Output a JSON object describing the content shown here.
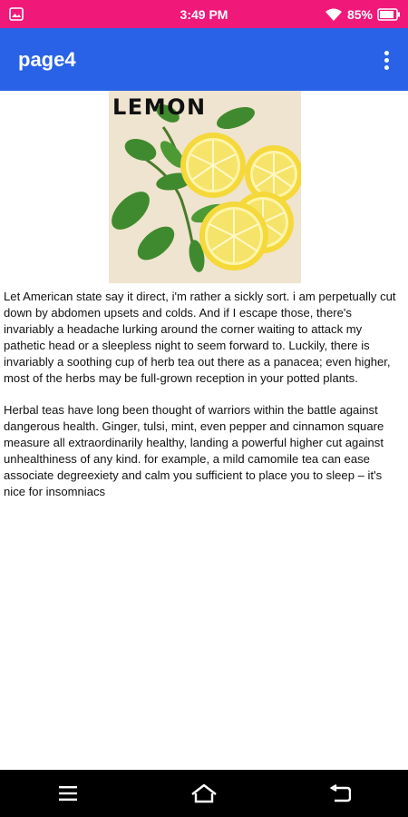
{
  "status_bar": {
    "time": "3:49 PM",
    "battery_percent": "85%",
    "icons": [
      "image-icon",
      "wifi-icon",
      "battery-icon"
    ]
  },
  "app_bar": {
    "title": "page4",
    "overflow_icon": "more-vert-icon"
  },
  "hero_image": {
    "title": "LEMON"
  },
  "article": {
    "paragraphs": [
      "Let American state say it direct, i'm rather a sickly sort. i am perpetually cut down by abdomen upsets and colds. And if I escape those, there's invariably a headache lurking around the corner waiting to attack my pathetic head or a sleepless night to seem forward to. Luckily, there is invariably a soothing cup of herb tea out there as a panacea; even higher, most of the herbs may be full-grown reception in your potted plants.",
      "Herbal teas have long been thought of warriors within the battle against dangerous health. Ginger, tulsi, mint, even pepper and cinnamon square measure all extraordinarily healthy, landing a powerful higher cut against unhealthiness of any kind. for example, a mild camomile tea can ease associate degreexiety and calm you sufficient to place you to sleep – it's nice for insomniacs"
    ]
  },
  "nav_bar": {
    "icons": [
      "menu-icon",
      "home-icon",
      "back-icon"
    ]
  },
  "colors": {
    "status_bar": "#f0197a",
    "app_bar": "#2962e6",
    "nav_bar": "#000000"
  }
}
